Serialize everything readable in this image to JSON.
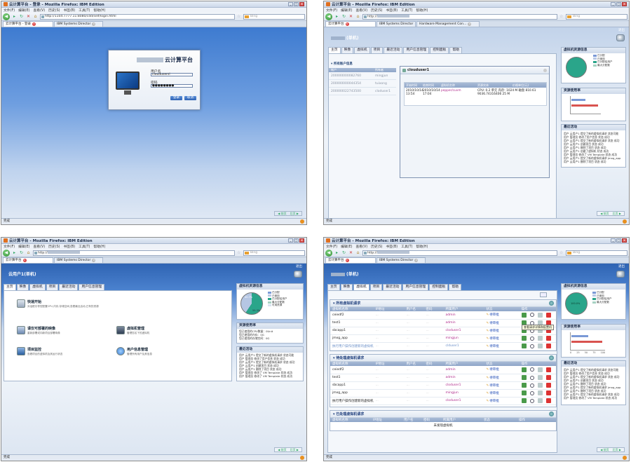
{
  "browser": {
    "title1": "云计算平台 - 登录 - Mozilla Firefox: IBM Edition",
    "title2": "云计算平台 - Mozilla Firefox: IBM Edition",
    "menu": [
      "文件(F)",
      "编辑(E)",
      "查看(V)",
      "历史(S)",
      "书签(B)",
      "工具(T)",
      "帮助(H)"
    ],
    "url1": "http://1104:7777.11:8080/cdd/self/login.html",
    "url2": "http://",
    "url3": "http://",
    "url4": "http://",
    "search_placeholder": "Bing",
    "tab_app1": "云计算平台 - 登录",
    "tab_app2": "云计算平台",
    "tab_ibm": "IBM Systems Director",
    "tab_hw": "Hardware Management Con...",
    "status": "完成"
  },
  "login": {
    "title": "云计算平台",
    "username_label": "用户名",
    "username_value": "cloudusersl",
    "password_label": "密码",
    "password_value": "●●●●●●●●",
    "login_button": "登录",
    "reset_button": "取消"
  },
  "app": {
    "exit": "退出",
    "logo2": "(单机)",
    "logo3": "云用户1",
    "logo3_suffix": "(单机)",
    "logo4": "(单机)",
    "tabs_main": [
      "主页",
      "映像",
      "虚拟机",
      "项目",
      "最近活动",
      "用户信息管理",
      "控制面板",
      "帮助"
    ],
    "tabs_user": [
      "主页",
      "映像",
      "虚拟机",
      "项目",
      "最近活动",
      "用户信息管理"
    ]
  },
  "accounts": {
    "header": "▾ 所有账户信息",
    "col_account": "帐户",
    "col_user": "所有者",
    "rows": [
      {
        "account": "200000000082760",
        "user": "mingjun"
      },
      {
        "account": "200000000044354",
        "user": "tuixong"
      },
      {
        "account": "200000022743500",
        "user": "cloduser1"
      }
    ]
  },
  "dialog": {
    "title": "clouduser1",
    "cols": [
      "开始时间",
      "结束时间",
      "虚拟机名称",
      "资源实体",
      "价格单位(元)"
    ],
    "start": "2010/10/14 13:54",
    "end": "2010/10/14 17:04",
    "vm": "pepper/cuvm",
    "resource": "CPU: 0.2 单元  内存: 1024 M  磁盘",
    "price": "810.61",
    "resource2": "9036.74316406 25 M"
  },
  "welcome": {
    "items": [
      {
        "title": "快速开始",
        "desc": "对话框引导您配置CPU,内存,存储空间,查看最近活动,已有的资源"
      },
      {
        "title": "请仅可部署的映像",
        "desc": "重新部署或向新项目部署映像"
      },
      {
        "title": "虚拟机管理",
        "desc": "管理您名下的虚拟机"
      },
      {
        "title": "项目监控",
        "desc": "查看项目的虚拟机及其运行状态"
      },
      {
        "title": "用户信息管理",
        "desc": "管理所有用户及其信息"
      }
    ]
  },
  "sidebar": {
    "status_title": "虚拟机资源信息",
    "legend": [
      "已分配",
      "已使用",
      "已分配给用户",
      "最大分配数",
      "可用资源"
    ],
    "pie_labels": [
      "40.7%",
      "59.3%"
    ],
    "pie_label4": "100.0%",
    "cpu_title": "资源使用率",
    "cpu_ticks": [
      "0",
      "25",
      "50",
      "75",
      "100"
    ],
    "quota_title": "资源使用率",
    "quota_lines": [
      "您已使用的CPU数量：0Unit",
      "您已使用的内存：0G",
      "您已使用的存储空间：0G"
    ],
    "activity_title": "最近活动",
    "activities": [
      "用户 云用户1 提交了新的虚拟机请求 状态可能",
      "用户 管理员 修改了用户信息 状态 成功",
      "用户 云用户1 提交了新的虚拟机请求 状态 成功",
      "用户 云用户1 创建项目 状态 成功",
      "用户 云用户1 删除了项目 状态 成功",
      "用户 云用户1 创建了虚拟机 状态 成功",
      "用户 管理员 修改了 VM Template 状态 成功",
      "用户 云用户1 提交了新的虚拟机请求 jmxg_app",
      "用户 云用户1 删除了项目 状态 成功",
      "用户 云用户1 提交了新的虚拟机请求 状态 成功",
      "用户 管理员 修改了 VM Template 状态 成功",
      "用户 云用户1 提交了新的虚拟机请求 状态 成功",
      "用户 管理员 修改了 VM Template 状态 成功"
    ]
  },
  "vm_page": {
    "section1": "▾ 所有虚拟机请求",
    "section2": "▾ 待处理虚拟机请求",
    "section3": "▾ 已处理虚拟机请求",
    "cols": [
      "虚拟机名称",
      "IP地址",
      "用户名",
      "密码",
      "所属用户",
      "状态",
      "操作"
    ],
    "approve": "待审批",
    "rows1": [
      {
        "name": "ceiedf2",
        "user": "admin"
      },
      {
        "name": "test1",
        "user": "admin"
      },
      {
        "name": "sbcapp1",
        "user": "cloduser1"
      },
      {
        "name": "jmxg_app",
        "user": "mingjun"
      },
      {
        "name": "执行用户操作创建新的虚拟机",
        "user": "clduser1"
      }
    ],
    "rows2": [
      {
        "name": "ceiedf2",
        "user": "admin"
      },
      {
        "name": "test1",
        "user": "admin"
      },
      {
        "name": "sbcapp1",
        "user": "cloduser1"
      },
      {
        "name": "jmxg_app",
        "user": "mingjun"
      },
      {
        "name": "执行用户操作创建新的虚拟机",
        "user": "cloduser1"
      }
    ],
    "tooltip": "查看请求详情和配置机",
    "empty": "未发现虚拟机"
  },
  "pager": {
    "prev": "◀ 前页",
    "next": "后页 ▶"
  },
  "colors": {
    "accent": "#1c48b4",
    "header_bg": "#3e7bd0",
    "pie_green": "#2aa58a"
  }
}
